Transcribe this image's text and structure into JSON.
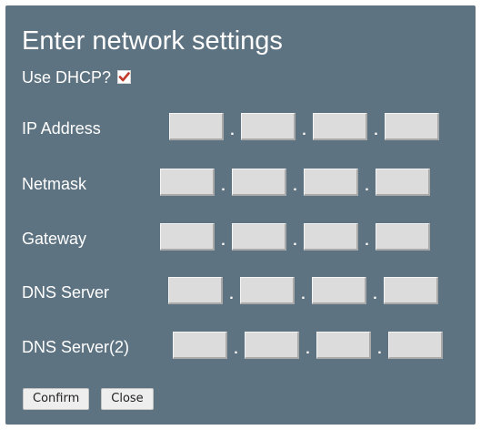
{
  "dialog": {
    "title": "Enter network settings",
    "dhcp_label": "Use DHCP?",
    "dhcp_checked": true
  },
  "fields": [
    {
      "label": "IP Address",
      "octets": [
        "",
        "",
        "",
        ""
      ]
    },
    {
      "label": "Netmask",
      "octets": [
        "",
        "",
        "",
        ""
      ]
    },
    {
      "label": "Gateway",
      "octets": [
        "",
        "",
        "",
        ""
      ]
    },
    {
      "label": "DNS Server",
      "octets": [
        "",
        "",
        "",
        ""
      ]
    },
    {
      "label": "DNS Server(2)",
      "octets": [
        "",
        "",
        "",
        ""
      ]
    }
  ],
  "separator": ".",
  "buttons": {
    "confirm": "Confirm",
    "close": "Close"
  },
  "colors": {
    "panel_background": "#5e7381",
    "checkmark": "#c0392b",
    "input_background": "#dcdcdc"
  }
}
